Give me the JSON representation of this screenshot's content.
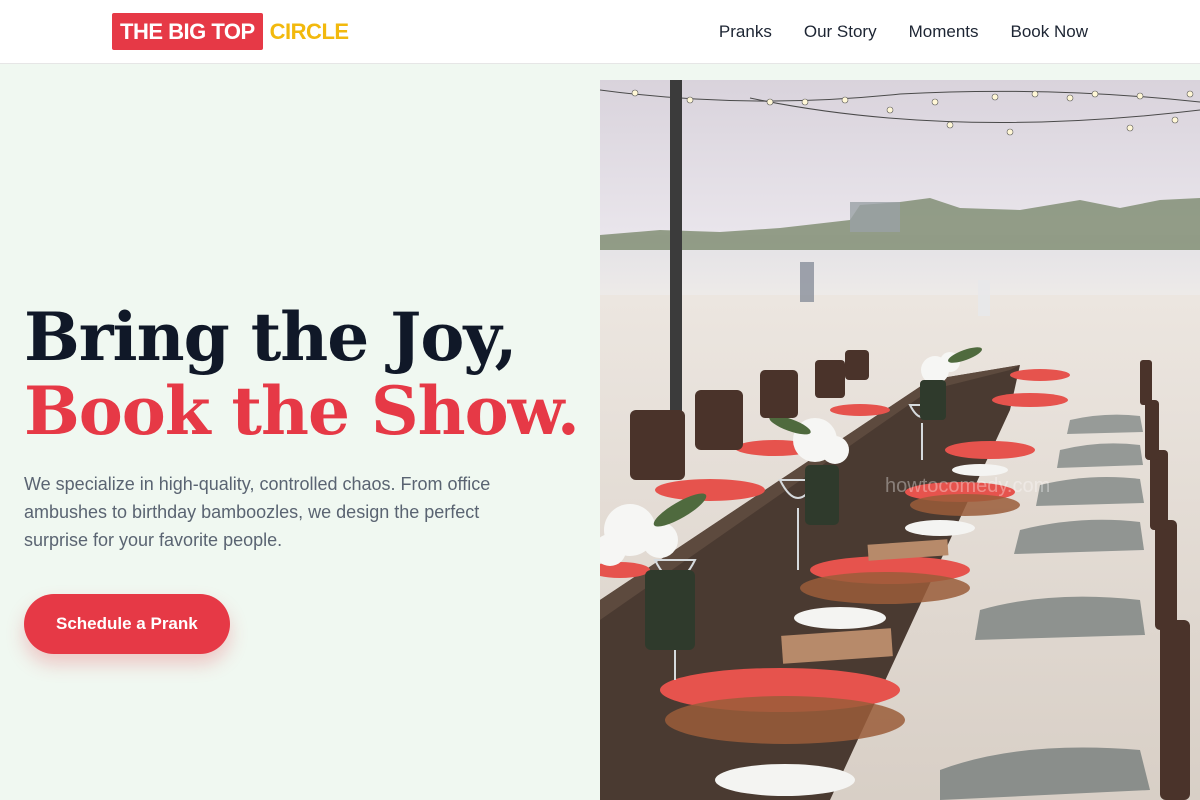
{
  "header": {
    "logo_main": "THE BIG TOP",
    "logo_accent": "CIRCLE",
    "nav": [
      "Pranks",
      "Our Story",
      "Moments",
      "Book Now"
    ]
  },
  "hero": {
    "headline_line1": "Bring the Joy,",
    "headline_line2": "Book the Show.",
    "lead": "We specialize in high-quality, controlled chaos. From office ambushes to birthday bamboozles, we design the perfect surprise for your favorite people.",
    "cta_label": "Schedule a Prank",
    "image_watermark": "howtocomedy.com"
  },
  "colors": {
    "brand_red": "#e63946",
    "brand_yellow": "#f2b90d",
    "headline_dark": "#101828",
    "page_bg": "#f0f8f1"
  }
}
